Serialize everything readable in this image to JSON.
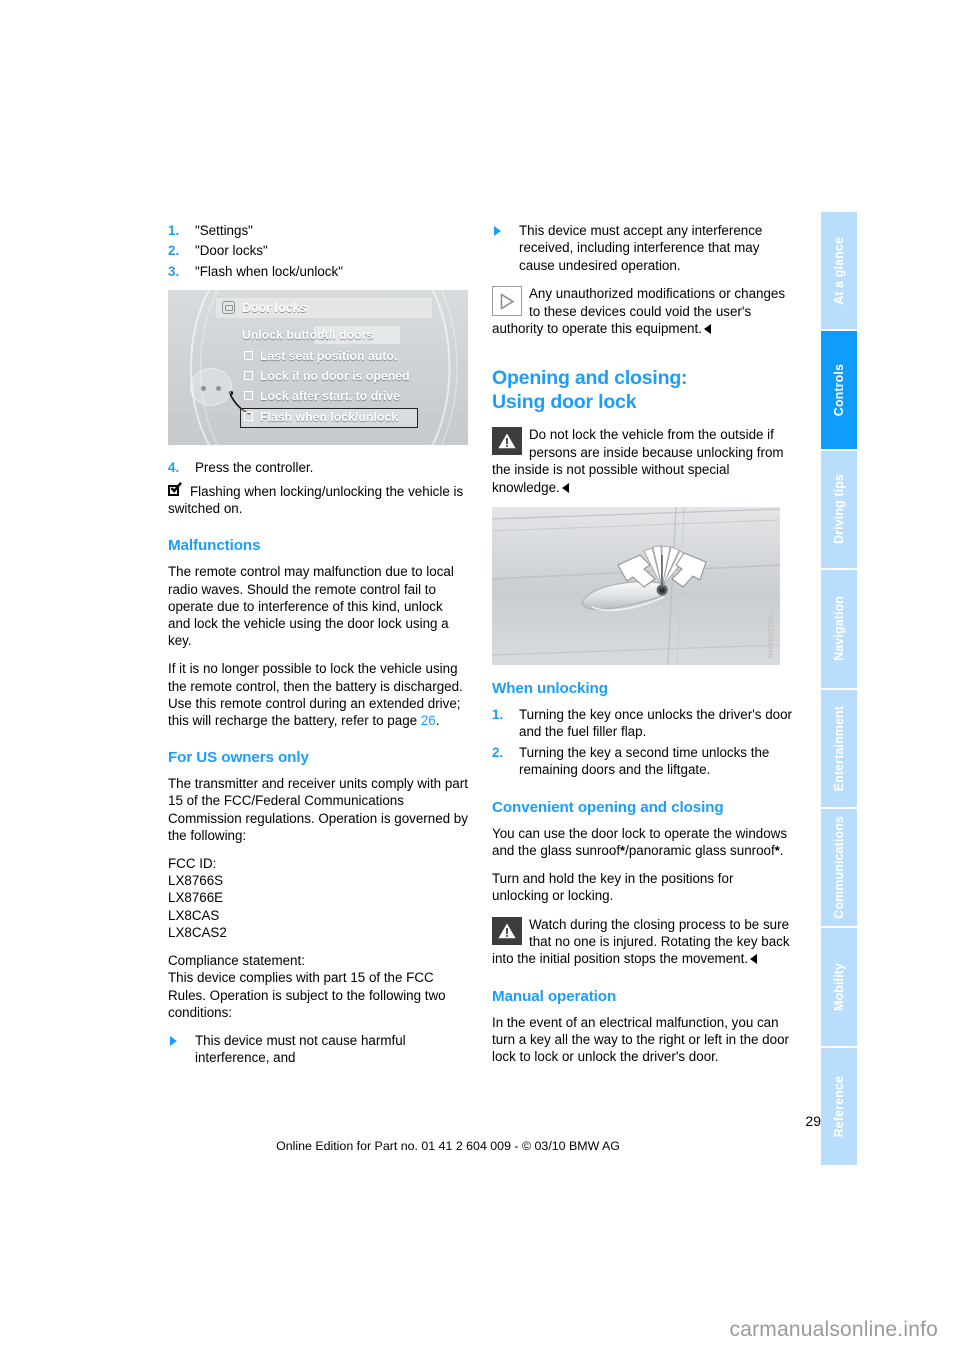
{
  "page": {
    "number": "29",
    "footer_line": "Online Edition for Part no. 01 41 2 604 009 - © 03/10 BMW AG",
    "watermark": "carmanualsonline.info"
  },
  "tab_rail": {
    "items": [
      {
        "label": "At a glance",
        "active": false
      },
      {
        "label": "Controls",
        "active": true
      },
      {
        "label": "Driving tips",
        "active": false
      },
      {
        "label": "Navigation",
        "active": false
      },
      {
        "label": "Entertainment",
        "active": false
      },
      {
        "label": "Communications",
        "active": false
      },
      {
        "label": "Mobility",
        "active": false
      },
      {
        "label": "Reference",
        "active": false
      }
    ],
    "active_color": "#0f9cfc",
    "inactive_color": "#b9ddfd"
  },
  "left_column": {
    "steps_top": [
      {
        "num": "1.",
        "text": "\"Settings\""
      },
      {
        "num": "2.",
        "text": "\"Door locks\""
      },
      {
        "num": "3.",
        "text": "\"Flash when lock/unlock\""
      }
    ],
    "idrive_figure": {
      "title": "Door locks",
      "unlock_button_label": "Unlock button:",
      "unlock_button_value": "All doors",
      "options": [
        "Last seat position auto.",
        "Lock if no door is opened",
        "Lock after start. to drive",
        "Flash when lock/unlock"
      ],
      "highlighted_option": "Flash when lock/unlock"
    },
    "step_four": {
      "num": "4.",
      "text": "Press the controller."
    },
    "checkbox_note": "Flashing when locking/unlocking the vehicle is switched on.",
    "malfunctions": {
      "heading": "Malfunctions",
      "para1": "The remote control may malfunction due to local radio waves. Should the remote control fail to operate due to interference of this kind, unlock and lock the vehicle using the door lock using a key.",
      "para2_a": "If it is no longer possible to lock the vehicle using the remote control, then the battery is discharged. Use this remote control during an extended drive; this will recharge the battery, refer to page ",
      "para2_link": "26",
      "para2_b": "."
    },
    "us_owners": {
      "heading": "For US owners only",
      "para1": "The transmitter and receiver units comply with part 15 of the FCC/Federal Communications Commission regulations. Operation is governed by the following:",
      "fcc_id_label": "FCC ID:",
      "fcc_ids": [
        "LX8766S",
        "LX8766E",
        "LX8CAS",
        "LX8CAS2"
      ],
      "compliance_label": "Compliance statement:",
      "compliance_text": "This device complies with part 15 of the FCC Rules. Operation is subject to the following two conditions:",
      "bullet1": "This device must not cause harmful interference, and"
    }
  },
  "right_column": {
    "bullet2": "This device must accept any interference received, including interference that may cause undesired operation.",
    "note_unauthorized": "Any unauthorized modifications or changes to these devices could void the user's authority to operate this equipment.",
    "section_title_line1": "Opening and closing:",
    "section_title_line2": "Using door lock",
    "warning_lock": "Do not lock the vehicle from the outside if persons are inside because unlocking from the inside is not possible without special knowledge.",
    "photo_credit": "WG1006MN",
    "when_unlocking": {
      "heading": "When unlocking",
      "steps": [
        {
          "num": "1.",
          "text": "Turning the key once unlocks the driver's door and the fuel filler flap."
        },
        {
          "num": "2.",
          "text": "Turning the key a second time unlocks the remaining doors and the liftgate."
        }
      ]
    },
    "convenient": {
      "heading": "Convenient opening and closing",
      "para1_a": "You can use the door lock to operate the windows and the glass sunroof",
      "para1_ast1": "*",
      "para1_b": "/panoramic glass sunroof",
      "para1_ast2": "*",
      "para1_c": ".",
      "para2": "Turn and hold the key in the positions for unlocking or locking.",
      "warning": "Watch during the closing process to be sure that no one is injured. Rotating the key back into the initial position stops the movement."
    },
    "manual_operation": {
      "heading": "Manual operation",
      "para1": "In the event of an electrical malfunction, you can turn a key all the way to the right or left in the door lock to lock or unlock the driver's door."
    }
  },
  "icons": {
    "checkbox_checked": "checkbox-checked-icon",
    "boxed_triangle": "boxed-triangle-note-icon",
    "warning_triangle": "warning-triangle-icon",
    "bullet_triangle": "triangle-bullet-icon",
    "end_mark": "end-of-note-arrow-icon"
  }
}
